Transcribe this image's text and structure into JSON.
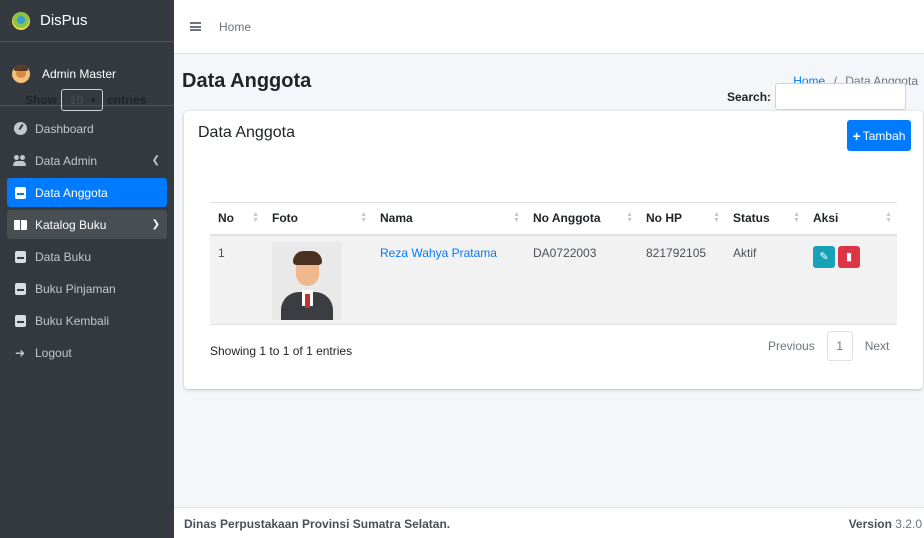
{
  "brand": {
    "name": "DisPus"
  },
  "user": {
    "name": "Admin Master"
  },
  "sidebar": {
    "items": [
      {
        "label": "Dashboard",
        "icon": "dashboard-icon"
      },
      {
        "label": "Data Admin",
        "icon": "users-icon"
      },
      {
        "label": "Data Anggota",
        "icon": "id-card-icon"
      },
      {
        "label": "Katalog Buku",
        "icon": "book-icon"
      },
      {
        "label": "Data Buku",
        "icon": "square-icon"
      },
      {
        "label": "Buku Pinjaman",
        "icon": "square-icon"
      },
      {
        "label": "Buku Kembali",
        "icon": "square-icon"
      },
      {
        "label": "Logout",
        "icon": "logout-icon"
      }
    ]
  },
  "topbar": {
    "home": "Home"
  },
  "page": {
    "title": "Data Anggota",
    "breadcrumb": {
      "home": "Home",
      "separator": "/",
      "current": "Data Anggota"
    }
  },
  "card": {
    "title": "Data Anggota",
    "add_button": "Tambah",
    "length": {
      "show": "Show",
      "value": "10",
      "entries": "entries"
    },
    "search_label": "Search:",
    "columns": [
      "No",
      "Foto",
      "Nama",
      "No Anggota",
      "No HP",
      "Status",
      "Aksi"
    ],
    "rows": [
      {
        "no": "1",
        "nama": "Reza Wahya Pratama",
        "no_anggota": "DA0722003",
        "no_hp": "821792105",
        "status": "Aktif"
      }
    ],
    "info": "Showing 1 to 1 of 1 entries",
    "pagination": {
      "previous": "Previous",
      "page": "1",
      "next": "Next"
    }
  },
  "footer": {
    "left": "Dinas Perpustakaan Provinsi Sumatra Selatan.",
    "version_label": "Version",
    "version": "3.2.0"
  },
  "colors": {
    "sidebar_bg": "#343a40",
    "primary": "#007bff",
    "info": "#17a2b8",
    "danger": "#dc3545"
  }
}
